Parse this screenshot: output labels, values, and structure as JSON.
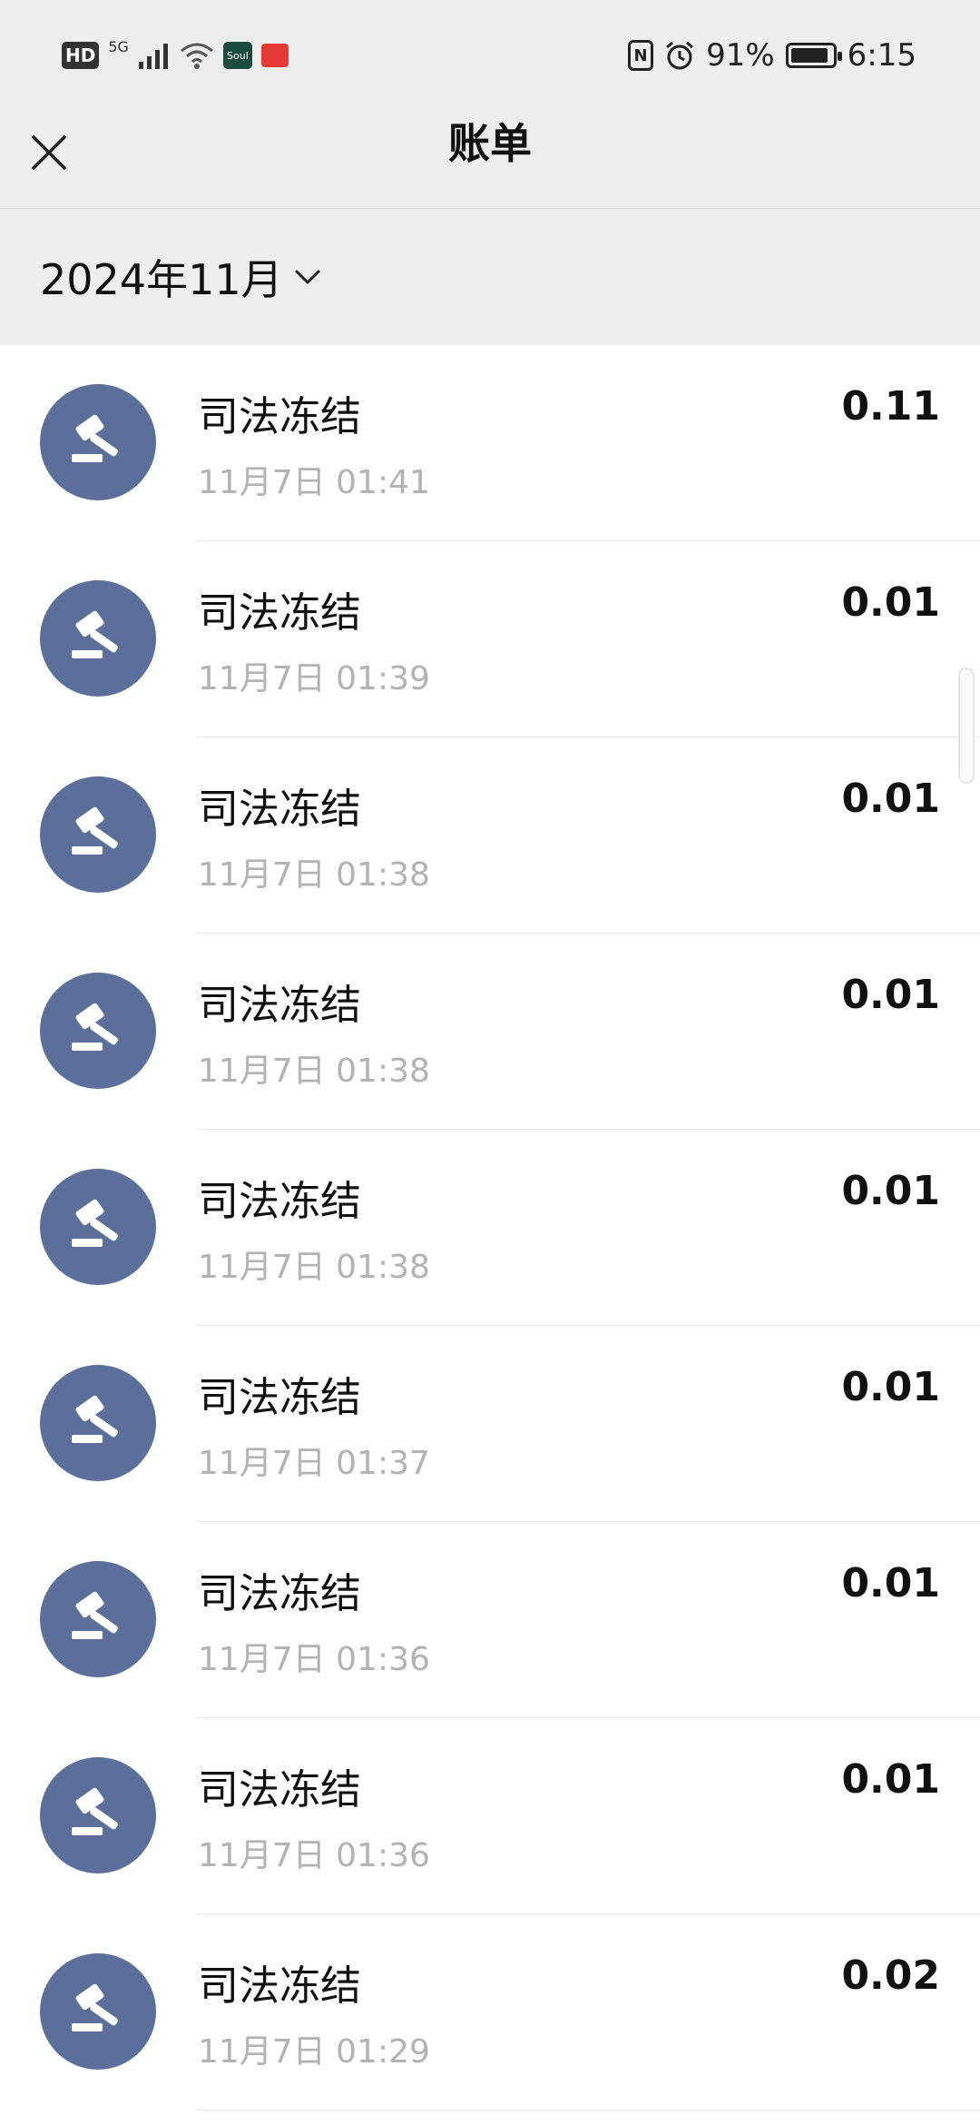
{
  "status_bar": {
    "hd": "HD",
    "network": "5G",
    "app_badge": "Soul",
    "battery": "91%",
    "battery_level": 0.91,
    "time": "6:15"
  },
  "header": {
    "title": "账单"
  },
  "month_filter": {
    "label": "2024年11月"
  },
  "colors": {
    "avatar": "#5b6f9a",
    "time_text": "#b2b2b2",
    "background": "#ededed"
  },
  "transactions": [
    {
      "title": "司法冻结",
      "time": "11月7日 01:41",
      "amount": "0.11",
      "icon": "gavel-icon"
    },
    {
      "title": "司法冻结",
      "time": "11月7日 01:39",
      "amount": "0.01",
      "icon": "gavel-icon"
    },
    {
      "title": "司法冻结",
      "time": "11月7日 01:38",
      "amount": "0.01",
      "icon": "gavel-icon"
    },
    {
      "title": "司法冻结",
      "time": "11月7日 01:38",
      "amount": "0.01",
      "icon": "gavel-icon"
    },
    {
      "title": "司法冻结",
      "time": "11月7日 01:38",
      "amount": "0.01",
      "icon": "gavel-icon"
    },
    {
      "title": "司法冻结",
      "time": "11月7日 01:37",
      "amount": "0.01",
      "icon": "gavel-icon"
    },
    {
      "title": "司法冻结",
      "time": "11月7日 01:36",
      "amount": "0.01",
      "icon": "gavel-icon"
    },
    {
      "title": "司法冻结",
      "time": "11月7日 01:36",
      "amount": "0.01",
      "icon": "gavel-icon"
    },
    {
      "title": "司法冻结",
      "time": "11月7日 01:29",
      "amount": "0.02",
      "icon": "gavel-icon"
    }
  ]
}
